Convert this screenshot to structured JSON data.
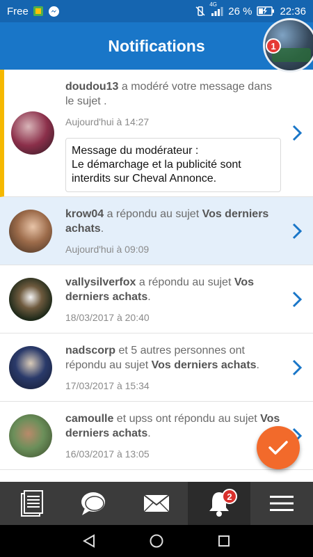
{
  "status_bar": {
    "carrier": "Free",
    "network": "4G",
    "battery": "26 %",
    "time": "22:36"
  },
  "header": {
    "title": "Notifications",
    "profile_badge": "1"
  },
  "notifications": [
    {
      "user": "doudou13",
      "text": " a modéré votre message dans le sujet .",
      "subject": "",
      "time": "Aujourd'hui à 14:27",
      "moderator_message": {
        "line1": "Message du modérateur :",
        "line2": "Le démarchage et la publicité sont interdits sur Cheval Annonce."
      }
    },
    {
      "user": "krow04",
      "text": " a répondu au sujet ",
      "subject": "Vos derniers achats",
      "tail": ".",
      "time": "Aujourd'hui à 09:09"
    },
    {
      "user": "vallysilverfox",
      "text": " a répondu au sujet ",
      "subject": "Vos derniers achats",
      "tail": ".",
      "time": "18/03/2017 à 20:40"
    },
    {
      "user": "nadscorp",
      "text": " et 5 autres personnes ont répondu au sujet ",
      "subject": "Vos derniers achats",
      "tail": ".",
      "time": "17/03/2017 à 15:34"
    },
    {
      "user": "camoulle",
      "text": " et upss ont répondu au sujet ",
      "subject": "Vos derniers achats",
      "tail": ".",
      "time": "16/03/2017 à 13:05"
    }
  ],
  "bottom_nav": {
    "notification_badge": "2",
    "items": [
      "document-icon",
      "chat-bubble-icon",
      "mail-icon",
      "bell-icon",
      "menu-icon"
    ]
  },
  "colors": {
    "primary": "#1976c8",
    "accent": "#f26a2b",
    "unread_marker": "#f5b800",
    "highlight": "#e4effa",
    "chevron": "#1976c8"
  }
}
